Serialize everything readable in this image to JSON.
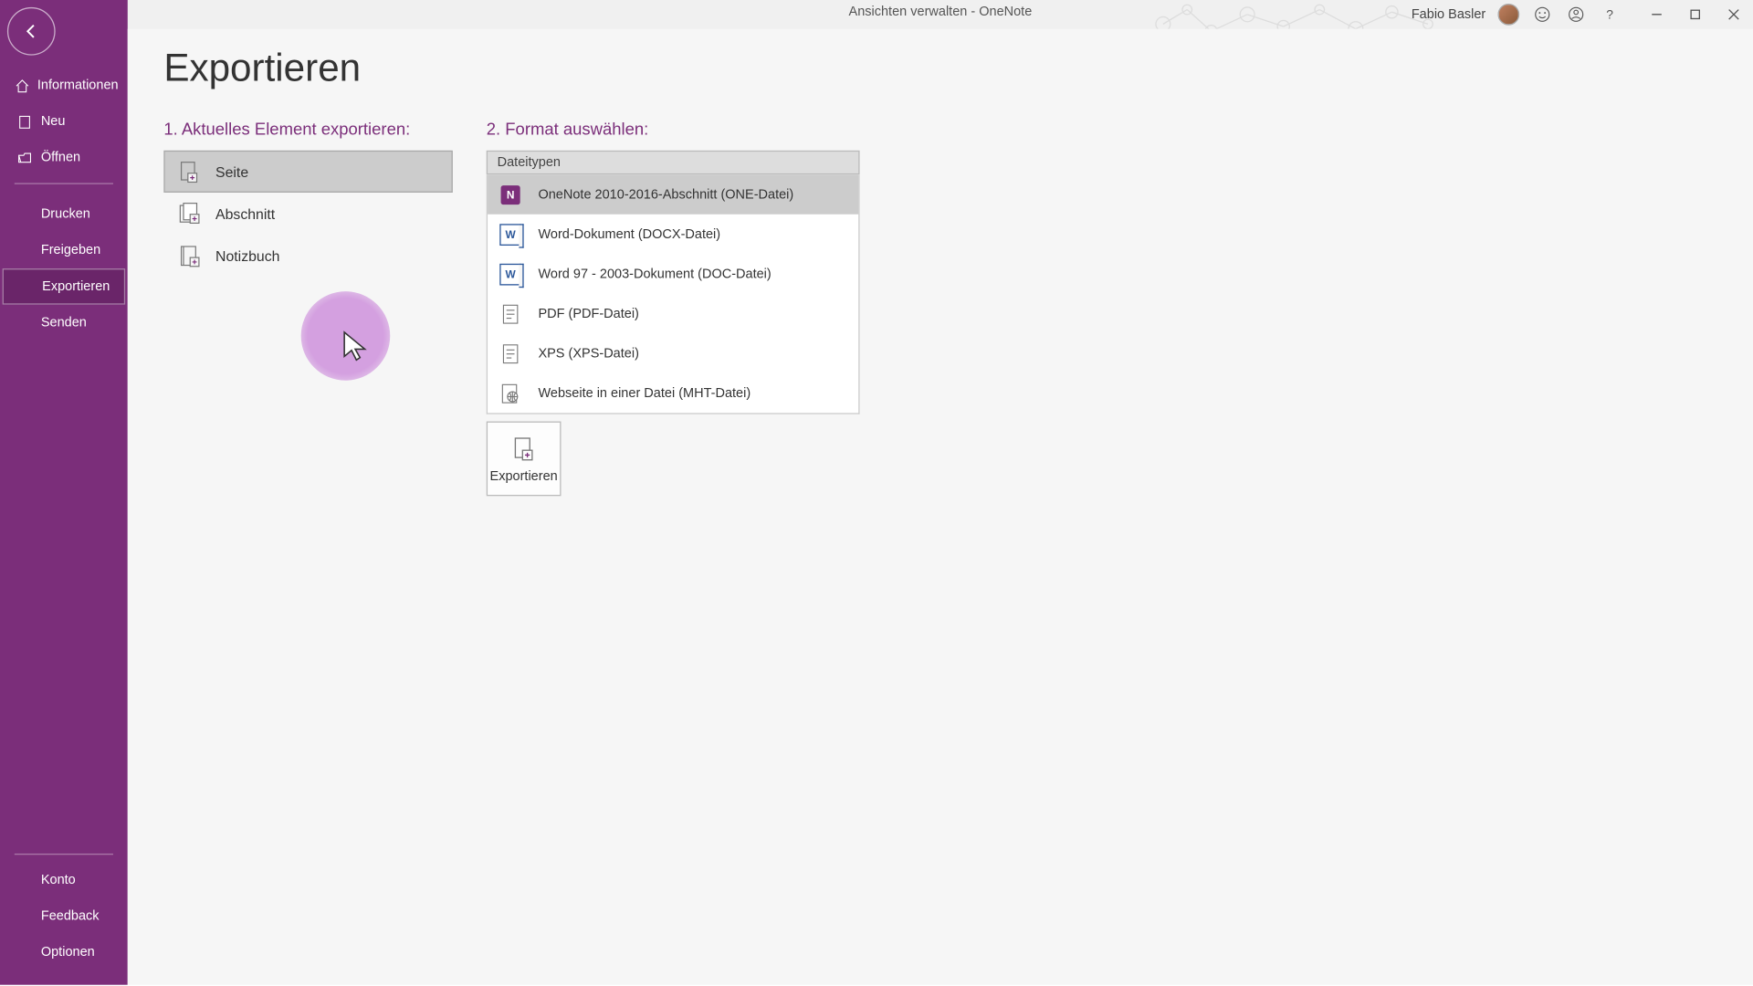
{
  "window": {
    "title": "Ansichten verwalten  -  OneNote",
    "user": "Fabio Basler"
  },
  "sidebar": {
    "back": "Zurück",
    "top": [
      {
        "label": "Informationen"
      },
      {
        "label": "Neu"
      },
      {
        "label": "Öffnen"
      }
    ],
    "mid": [
      {
        "label": "Drucken"
      },
      {
        "label": "Freigeben"
      },
      {
        "label": "Exportieren",
        "selected": true
      },
      {
        "label": "Senden"
      }
    ],
    "bottom": [
      {
        "label": "Konto"
      },
      {
        "label": "Feedback"
      },
      {
        "label": "Optionen"
      }
    ]
  },
  "export": {
    "title": "Exportieren",
    "step1": "1. Aktuelles Element exportieren:",
    "elements": [
      {
        "label": "Seite",
        "selected": true
      },
      {
        "label": "Abschnitt"
      },
      {
        "label": "Notizbuch"
      }
    ],
    "step2": "2. Format auswählen:",
    "formatHeader": "Dateitypen",
    "formats": [
      {
        "label": "OneNote 2010-2016-Abschnitt (ONE-Datei)",
        "icon": "onenote",
        "selected": true
      },
      {
        "label": "Word-Dokument (DOCX-Datei)",
        "icon": "word"
      },
      {
        "label": "Word 97 - 2003-Dokument (DOC-Datei)",
        "icon": "word"
      },
      {
        "label": "PDF (PDF-Datei)",
        "icon": "page"
      },
      {
        "label": "XPS (XPS-Datei)",
        "icon": "page"
      },
      {
        "label": "Webseite in einer Datei (MHT-Datei)",
        "icon": "web"
      }
    ],
    "exportBtn": "Exportieren"
  }
}
